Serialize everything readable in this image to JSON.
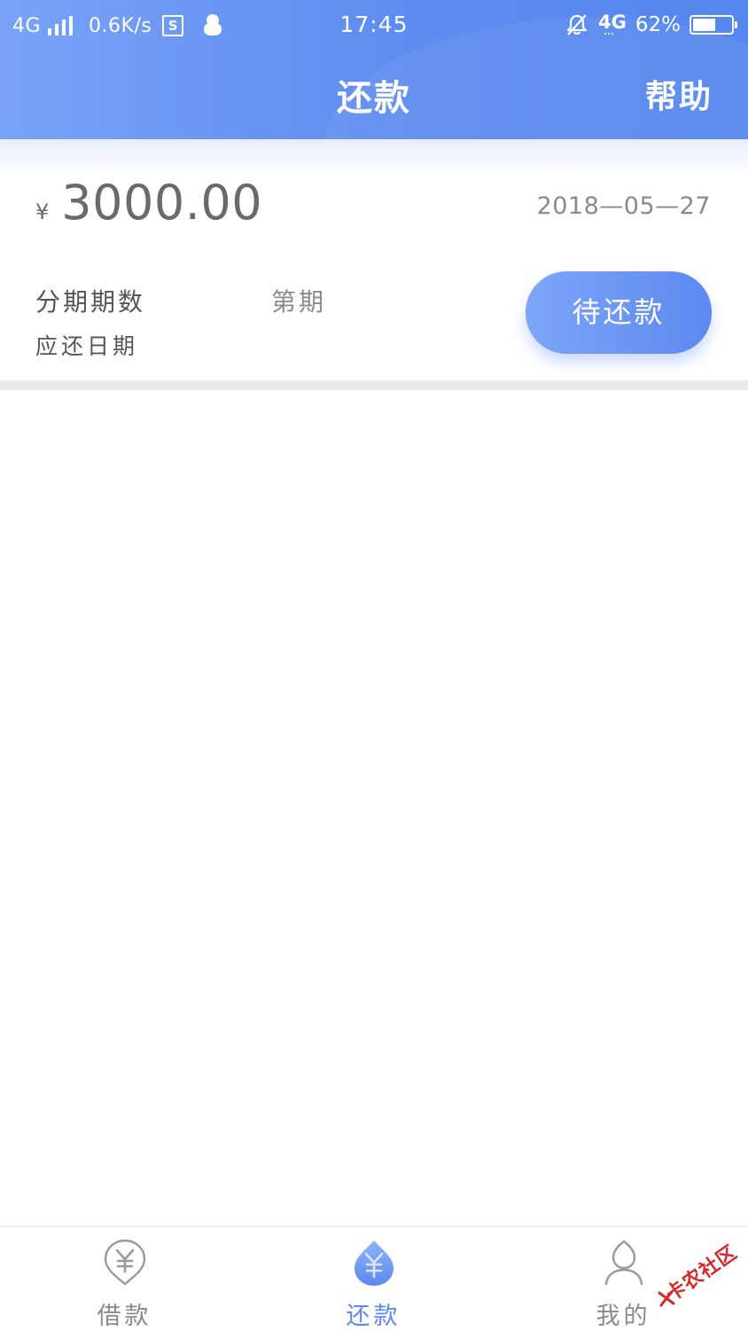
{
  "status_bar": {
    "network_left": "4G",
    "speed": "0.6K/s",
    "s_icon_letter": "S",
    "time": "17:45",
    "network_right": "4G",
    "battery_percent_text": "62%",
    "battery_level": 0.62,
    "icons": [
      "signal-bars-icon",
      "s-box-icon",
      "penguin-icon",
      "bell-muted-icon",
      "battery-icon"
    ]
  },
  "nav": {
    "title": "还款",
    "help": "帮助"
  },
  "repayment": {
    "currency_symbol": "¥",
    "amount": "3000.00",
    "date": "2018—05—27",
    "periods_label": "分期期数",
    "periods_value": "第期",
    "due_date_label": "应还日期",
    "status_button": "待还款"
  },
  "tabs": [
    {
      "label": "借款",
      "icon": "yen-pin-icon",
      "active": false
    },
    {
      "label": "还款",
      "icon": "yen-drop-icon",
      "active": true
    },
    {
      "label": "我的",
      "icon": "user-icon",
      "active": false
    }
  ],
  "watermark": {
    "text": "卡农社区"
  },
  "colors": {
    "brand": "#5b89ef",
    "brand_light": "#7ea6f8",
    "text_muted": "#8a8a8a",
    "divider": "#ebebee"
  }
}
